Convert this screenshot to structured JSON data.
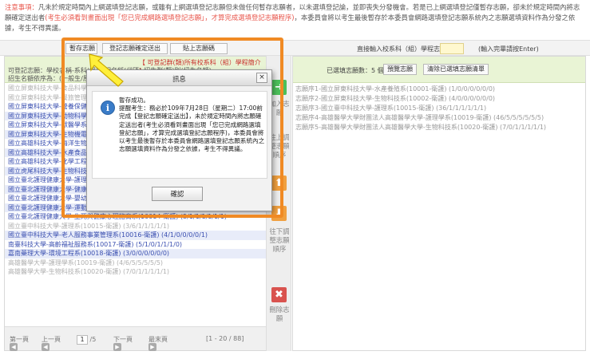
{
  "notice": {
    "label": "注意事項：",
    "text_a": "凡未於規定時間內上網選填登記志願，或雖有上網選填登記志願但未做任何暫存志願者，以未選填登記論，並即喪失分發機會。若是已上網選填登記僅暫存志願，卻未於規定時間內將志願確定送出者",
    "text_red": "(考生必須看到畫面出現「您已完成網路選填登記志願」，才算完成選填登記志願程序)",
    "text_b": "，本委員會將以考生最後暫存於本委員會網路選填登記志願系統內之志願選填資料作為分發之依據，考生不得異議。"
  },
  "toolbar": {
    "save_label": "暫存志願",
    "confirm_label": "登記志願確定送出",
    "paste_label": "貼上志願碼",
    "direct_label": "直接輸入校系科（組）學程志願代碼：",
    "code_hint": "(輸入完畢請按Enter)"
  },
  "left": {
    "links": "【 可登記群(類)所有校系科（組）學程簡介 】",
    "line1": "可登記志願：學校名稱-系科(組)學程名稱(代碼)-招生群(類)別(招生名額)",
    "line2": "招生名額依序為：(一般生/原住民/身心障礙生/其他)",
    "items": [
      {
        "text": "國立屏東科技大學-食品科學系(10003-衛護) (6/1/1/1/1/1/1)",
        "style": "grey"
      },
      {
        "text": "國立屏東科技大學-餐旅管理系(10004-衛護) (5/1/1/1/1/1/1)",
        "style": "grey"
      },
      {
        "text": "國立屏東科技大學-營養保健系(10005-衛護) (4/1/1/1/1/1/1)",
        "style": "blue"
      },
      {
        "text": "國立屏東科技大學-動物科學與畜產系(10006-衛護) (3/1/1/1/1/1/1)",
        "style": "blue-alt"
      },
      {
        "text": "國立屏東科技大學-獸醫學系(10007-衛護) (2/1/1/1/1/1/1)",
        "style": "blue"
      },
      {
        "text": "國立屏東科技大學-生物機電系(10008-衛護) (3/1/1/1/1/1/1)",
        "style": "blue-alt"
      },
      {
        "text": "國立高雄科技大學-海洋生物技術系(10009-衛護) (4/1/1/1/1/1/1)",
        "style": "blue"
      },
      {
        "text": "國立高雄科技大學-水產食品科學系(10010-衛護) (4/1/1/1/1/1/1)",
        "style": "blue-alt"
      },
      {
        "text": "國立高雄科技大學-化學工程系(10011-衛護) (3/1/1/1/1/1/1)",
        "style": "blue"
      },
      {
        "text": "國立虎尾科技大學-生物科技系(10012-衛護) (3/1/1/1/1/1/1)",
        "style": "blue-alt"
      },
      {
        "text": "國立臺北護理健康大學-護理系(10013-衛護) (5/1/1/1/1/1/1)",
        "style": "blue"
      },
      {
        "text": "國立臺北護理健康大學-健康事業管理系(10014-衛護) (4/1/1/1/1/1/1)",
        "style": "blue-alt"
      },
      {
        "text": "國立臺北護理健康大學-嬰幼兒保育系(10015-衛護) (3/1/1/1/1/1/1)",
        "style": "blue"
      },
      {
        "text": "國立臺北護理健康大學-運動保健系(10013-衛護) (6/1/1/1/1/1/1)",
        "style": "blue-alt"
      },
      {
        "text": "國立臺北護理健康大學-生死與健康心理諮商系(10014-衛護) (5/1/1/1/1/1/1)",
        "style": "blue"
      },
      {
        "text": "國立臺中科技大學-護理系(10015-衛護) (3/6/1/1/1/1/1)",
        "style": "grey"
      },
      {
        "text": "國立臺中科技大學-老人服務事業管理系(10016-衛護) (4/1/0/0/0/0/1)",
        "style": "blue-alt"
      },
      {
        "text": "南臺科技大學-高齡福祉服務系(10017-衛護) (5/1/0/1/1/1/0)",
        "style": "blue"
      },
      {
        "text": "嘉南藥理大學-環境工程系(10018-衛護) (3/0/0/0/0/0/0)",
        "style": "blue-alt"
      },
      {
        "text": "高雄醫學大學-護理學系(10019-衛護) (4/6/5/5/5/5/5)",
        "style": "grey"
      },
      {
        "text": "高雄醫學大學-生物科技系(10020-衛護) (7/0/1/1/1/1/1)",
        "style": "grey"
      }
    ],
    "pager": {
      "first": "第一頁",
      "prev": "上一頁",
      "page": "1",
      "total": "/5",
      "next": "下一頁",
      "last": "最末頁",
      "range": "[1 - 20 / 88]"
    }
  },
  "middle": {
    "add_label": "加入志願",
    "up_label": "往上調整志願順序",
    "down_label": "往下調整志願順序",
    "delete_label": "刪除志願"
  },
  "right": {
    "count_label": "已選填志願數：5 個",
    "preview_label": "預覽志願",
    "clear_label": "清除已選填志願清單",
    "items": [
      "志願序1-國立屏東科技大學-水產養殖系(10001-衛護) (1/0/0/0/0/0/0)",
      "志願序2-國立屏東科技大學-生物科技系(10002-衛護) (4/0/0/0/0/0/0)",
      "志願序3-國立臺中科技大學-護理系(10015-衛護) (36/1/1/1/1/1/1)",
      "志願序4-高雄醫學大學財團法人高雄醫學大學-護理學系(10019-衛護) (46/5/5/5/5/5/5)",
      "志願序5-高雄醫學大學財團法人高雄醫學大學-生物科技系(10020-衛護) (7/0/1/1/1/1/1)"
    ]
  },
  "dialog": {
    "title": "訊息",
    "close": "×",
    "icon": "i",
    "message": "暫存成功。\n提醒考生：務必於109年7月28日（星期二）17:00前完成【登記志願確定送出】，未於規定時間內將志願確定送出者(考生必須看到畫面出現「您已完成網路選填登記志願」，才算完成選填登記志願程序)，本委員會將以考生最後暫存於本委員會網路選填登記志願系統內之志願選填資料作為分發之依據，考生不得異議。",
    "ok": "確認"
  },
  "colors": {
    "highlight": "#f08a24",
    "add": "#4cbf5a",
    "move": "#f0a040",
    "delete": "#d9534f",
    "link": "#c9302c"
  },
  "icons": {
    "add": "arrow-right-icon",
    "up": "arrow-up-icon",
    "down": "arrow-down-icon",
    "delete": "x-icon",
    "info": "info-icon"
  }
}
